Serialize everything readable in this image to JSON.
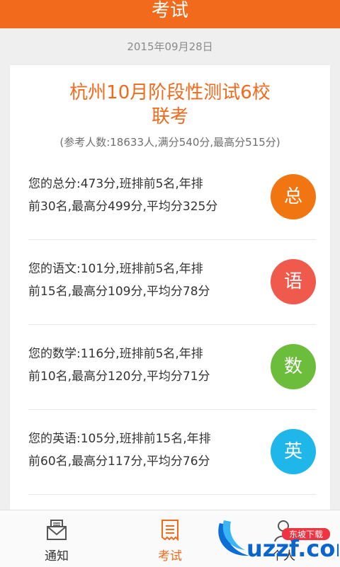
{
  "header": {
    "title": "考试"
  },
  "date": "2015年09月28日",
  "exam": {
    "title_line1": "杭州10月阶段性测试6校",
    "title_line2": "联考",
    "subtitle": "(参考人数:18633人,满分540分,最高分515分)"
  },
  "scores": [
    {
      "line1": "您的总分:473分,班排前5名,年排",
      "line2": "前30名,最高分499分,平均分325分",
      "badge": "总",
      "color": "#f17612"
    },
    {
      "line1": "您的语文:101分,班排前5名,年排",
      "line2": "前15名,最高分109分,平均分78分",
      "badge": "语",
      "color": "#ef5a4d"
    },
    {
      "line1": "您的数学:116分,班排前5名,年排",
      "line2": "前10名,最高分120分,平均分71分",
      "badge": "数",
      "color": "#6cbd3c"
    },
    {
      "line1": "您的英语:105分,班排前15名,年排",
      "line2": "前60名,最高分117分,平均分76分",
      "badge": "英",
      "color": "#1fb6ea"
    }
  ],
  "tabs": {
    "notice": "通知",
    "exam": "考试",
    "profile": "个人"
  },
  "watermark": {
    "text": "uzzf.com",
    "small": "东坡下载"
  },
  "colors": {
    "accent": "#f26a1b",
    "header": "#f26a1b"
  }
}
